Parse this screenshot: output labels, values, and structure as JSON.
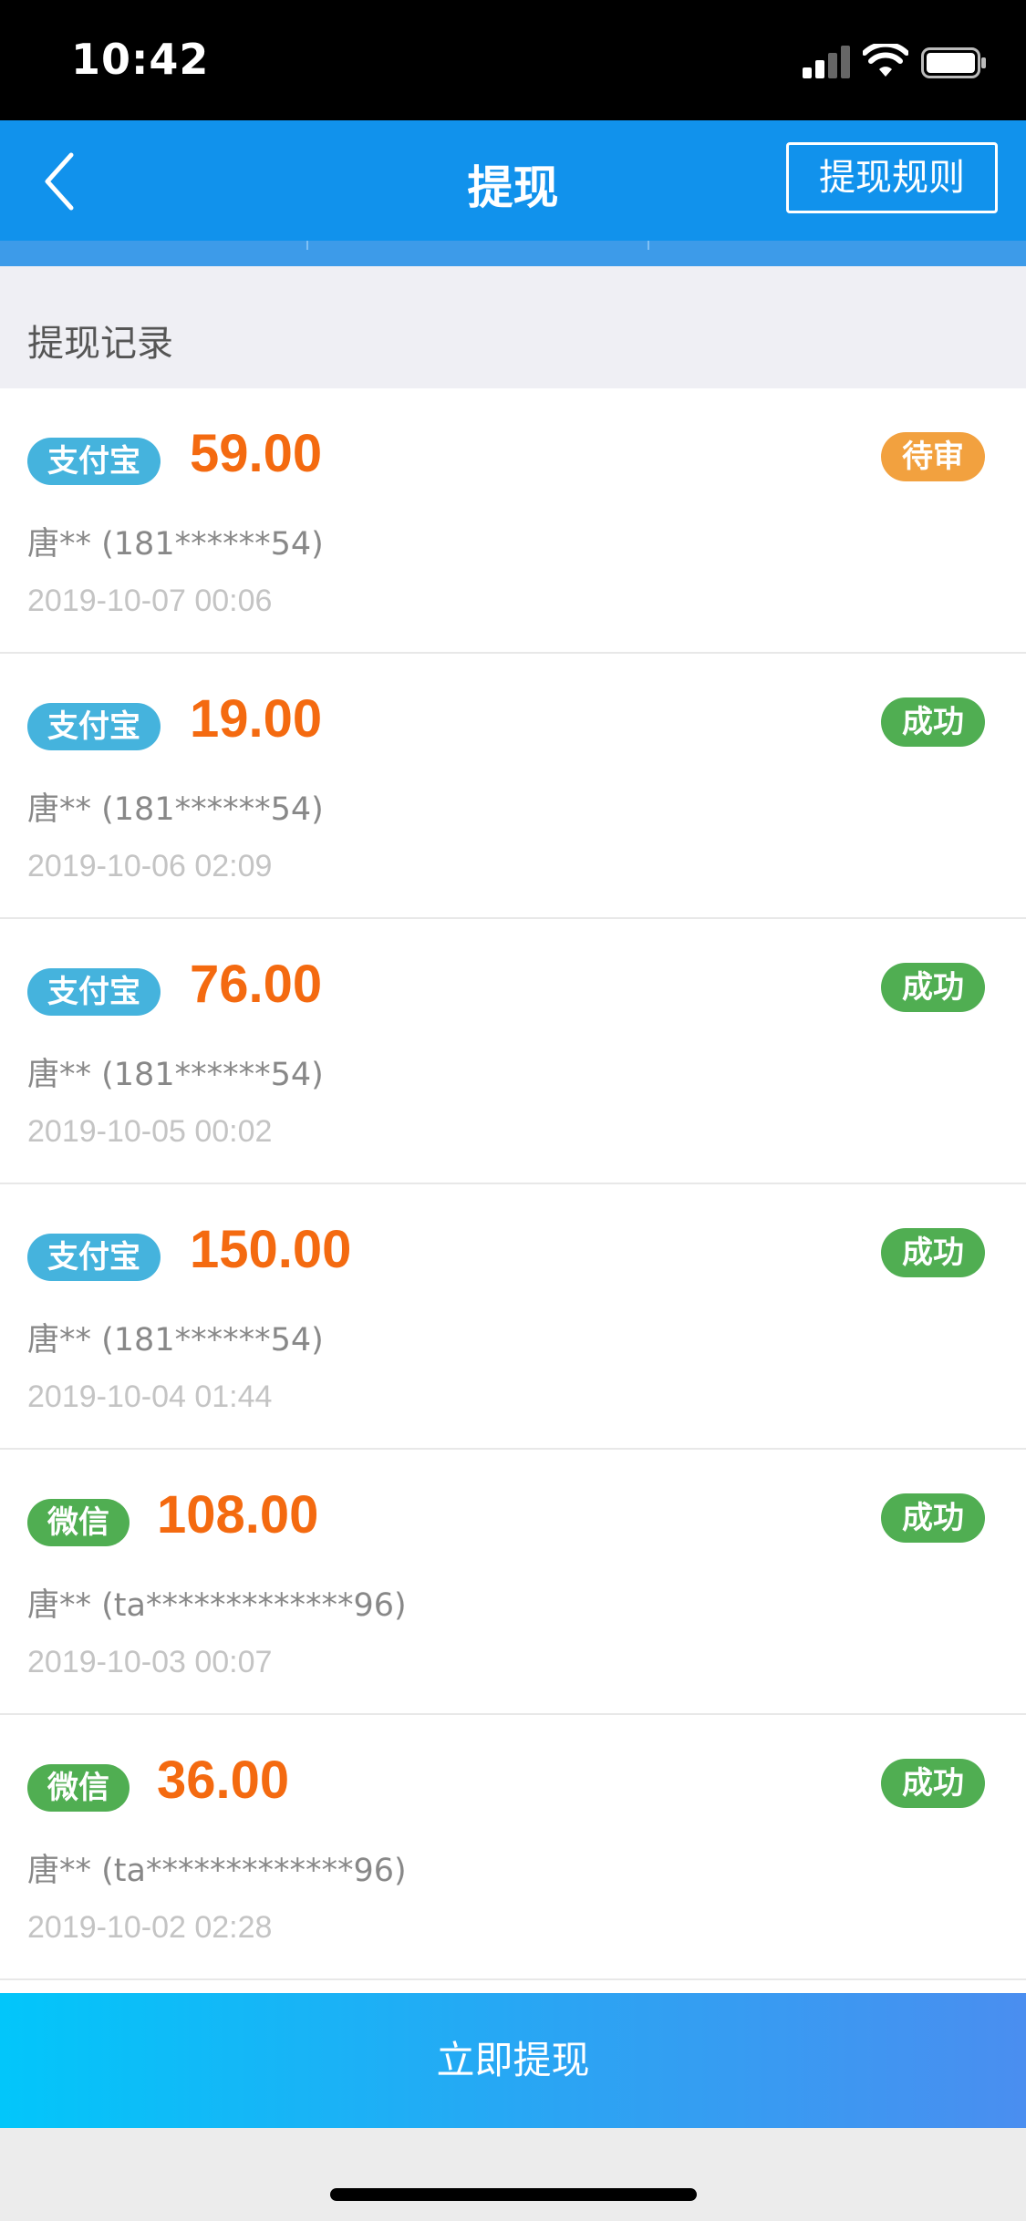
{
  "status_bar": {
    "time": "10:42"
  },
  "nav": {
    "title": "提现",
    "rules_label": "提现规则"
  },
  "section": {
    "title": "提现记录"
  },
  "records": [
    {
      "method": "支付宝",
      "amount": "59.00",
      "status": "待审",
      "account": "唐**  (181******54)",
      "time": "2019-10-07 00:06"
    },
    {
      "method": "支付宝",
      "amount": "19.00",
      "status": "成功",
      "account": "唐**  (181******54)",
      "time": "2019-10-06 02:09"
    },
    {
      "method": "支付宝",
      "amount": "76.00",
      "status": "成功",
      "account": "唐**  (181******54)",
      "time": "2019-10-05 00:02"
    },
    {
      "method": "支付宝",
      "amount": "150.00",
      "status": "成功",
      "account": "唐**  (181******54)",
      "time": "2019-10-04 01:44"
    },
    {
      "method": "微信",
      "amount": "108.00",
      "status": "成功",
      "account": "唐**  (ta*************96)",
      "time": "2019-10-03 00:07"
    },
    {
      "method": "微信",
      "amount": "36.00",
      "status": "成功",
      "account": "唐**  (ta*************96)",
      "time": "2019-10-02 02:28"
    }
  ],
  "footer": {
    "withdraw_label": "立即提现"
  },
  "colors": {
    "nav_bg": "#1192ec",
    "amount": "#f46a10",
    "alipay_badge": "#45b3dd",
    "wechat_badge": "#50ae52",
    "pending_badge": "#f2a13f",
    "success_badge": "#50ae52"
  },
  "icons": {
    "back": "chevron-left-icon",
    "signal": "cellular-signal-icon",
    "wifi": "wifi-icon",
    "battery": "battery-icon"
  }
}
